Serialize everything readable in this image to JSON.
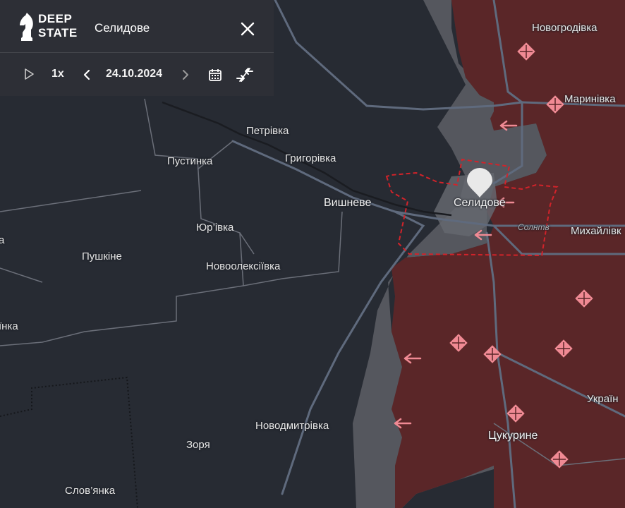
{
  "panel": {
    "brand_line1": "DEEP",
    "brand_line2": "STATE",
    "title": "Селидове",
    "speed": "1x",
    "date": "24.10.2024"
  },
  "icons": [
    "knight-logo-icon",
    "close-icon",
    "play-icon",
    "chevron-left-icon",
    "chevron-right-icon",
    "calendar-icon",
    "compare-arrows-icon",
    "location-pin-icon",
    "arrow-left-icon",
    "diamond-marker-icon"
  ],
  "colors": {
    "background": "#272b33",
    "occupied": "#5a2628",
    "contested": "#55575e",
    "frontline": "#d2232a",
    "marker": "#f08a94",
    "road": "#5f6a7d"
  },
  "places": {
    "novohrodivka": "Новогродівка",
    "marynivka": "Маринівка",
    "petrivka": "Петрівка",
    "hryhorivka": "Григорівка",
    "pustynka": "Пустинка",
    "vyshneve": "Вишневе",
    "selydove": "Селидове",
    "mykhailivka": "Михайлівк",
    "yurivka": "Юр’івка",
    "pushkine": "Пушкіне",
    "novooleksiivka": "Новоолексіївка",
    "left_edge_a": "а",
    "left_edge_b": "їнка",
    "ukrainsk": "Україн",
    "novodmytrivka": "Новодмитрівка",
    "zoria": "Зоря",
    "tsukuryne": "Цукурине",
    "slovianka": "Слов’янка",
    "road_label": "Солнтв"
  }
}
